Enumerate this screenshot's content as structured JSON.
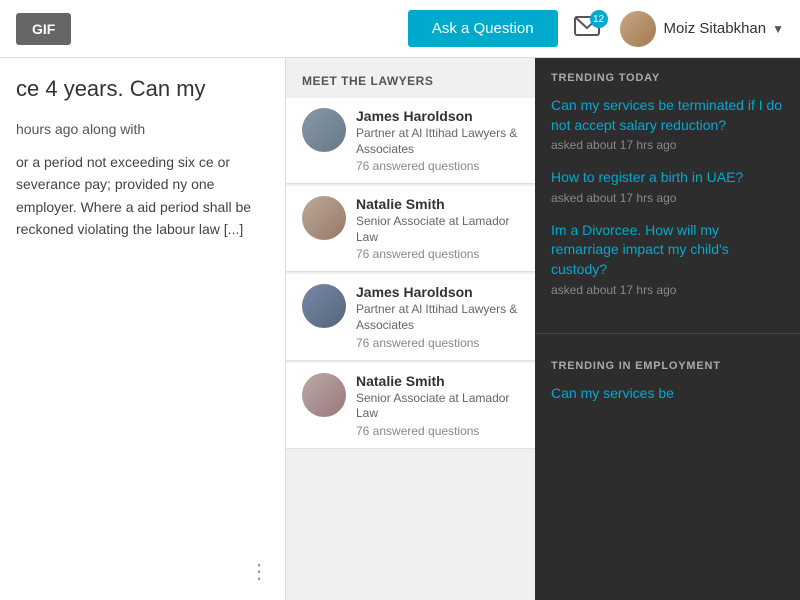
{
  "header": {
    "gif_label": "GIF",
    "ask_label": "Ask a Question",
    "mail_count": "12",
    "user_name": "Moiz Sitabkhan"
  },
  "article": {
    "title": "ce 4 years. Can my",
    "subtext": "hours ago along with",
    "body": "or a period not exceeding six\nce or severance pay; provided\nny one employer. Where a\naid period shall be reckoned\nviolating the labour law [...]"
  },
  "lawyers_section": {
    "title": "MEET THE LAWYERS",
    "lawyers": [
      {
        "name": "James Haroldson",
        "title": "Partner at Al Ittihad Lawyers & Associates",
        "questions": "76 answered questions",
        "gender": "male1"
      },
      {
        "name": "Natalie Smith",
        "title": "Senior Associate at Lamador Law",
        "questions": "76 answered questions",
        "gender": "female1"
      },
      {
        "name": "James Haroldson",
        "title": "Partner at Al Ittihad Lawyers & Associates",
        "questions": "76 answered questions",
        "gender": "male2"
      },
      {
        "name": "Natalie Smith",
        "title": "Senior Associate at Lamador Law",
        "questions": "76 answered questions",
        "gender": "female2"
      }
    ]
  },
  "trending": {
    "today_title": "TRENDING TODAY",
    "today_items": [
      {
        "question": "Can my services be terminated if I do not accept salary reduction?",
        "time": "asked about 17 hrs ago"
      },
      {
        "question": "How to register a birth in UAE?",
        "time": "asked about 17 hrs ago"
      },
      {
        "question": "Im a Divorcee. How will my remarriage impact my child's custody?",
        "time": "asked about 17 hrs ago"
      }
    ],
    "employment_title": "TRENDING IN EMPLOYMENT",
    "employment_items": [
      {
        "question": "Can my services be",
        "time": ""
      }
    ]
  }
}
